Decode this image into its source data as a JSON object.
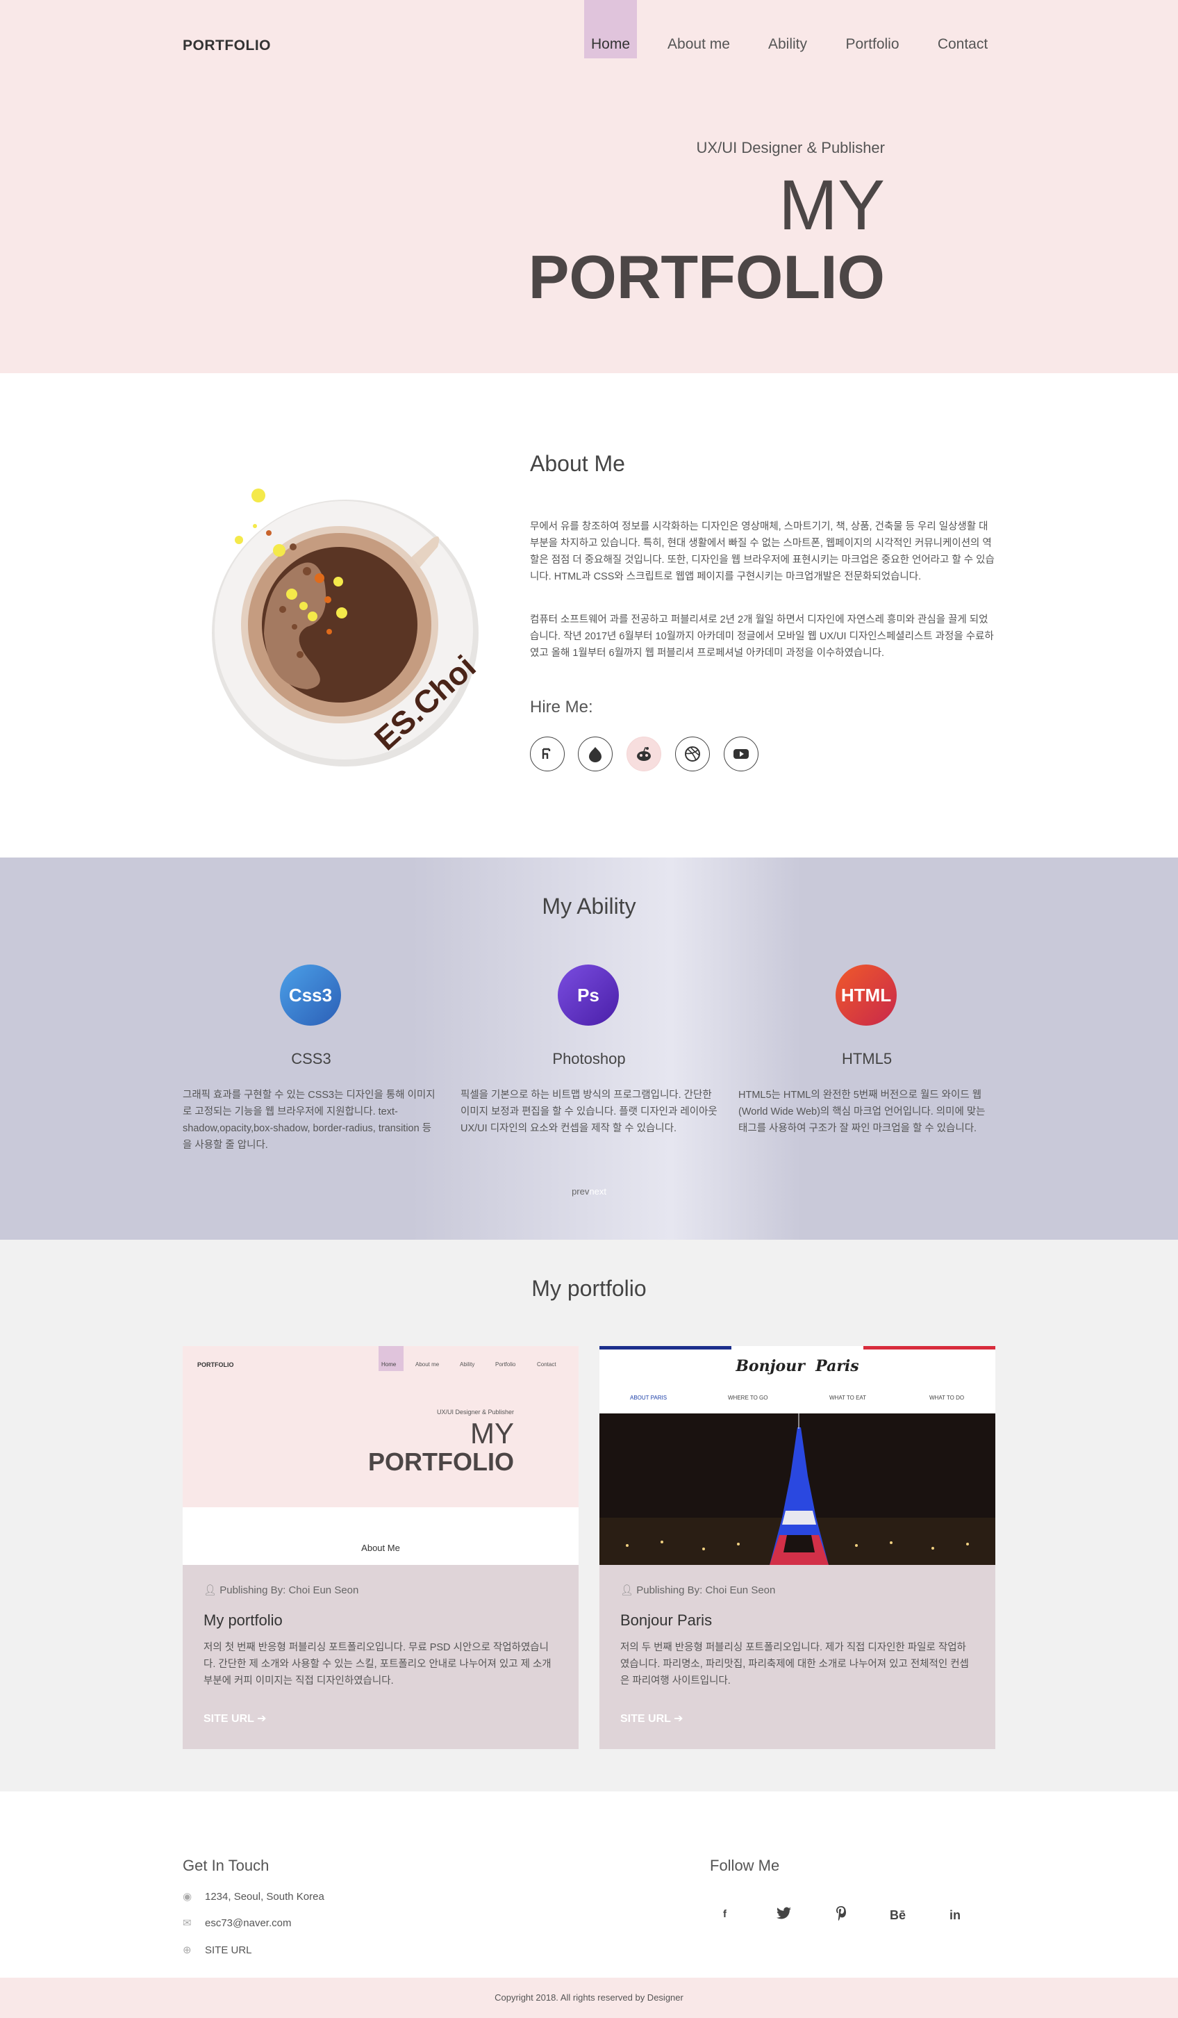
{
  "header": {
    "logo": "PORTFOLIO",
    "nav": [
      "Home",
      "About me",
      "Ability",
      "Portfolio",
      "Contact"
    ],
    "subtitle": "UX/UI Designer & Publisher",
    "title_line1": "MY",
    "title_line2": "PORTFOLIO"
  },
  "about": {
    "title": "About Me",
    "logo_text": "ES.Choi",
    "para1": "무에서 유를 창조하여 정보를 시각화하는 디자인은 영상매체, 스마트기기, 책, 상품, 건축물 등 우리 일상생활 대부분을 차지하고 있습니다. 특히, 현대 생활에서 빠질 수 없는 스마트폰, 웹페이지의 시각적인 커뮤니케이션의 역할은 점점 더 중요해질 것입니다. 또한, 디자인을 웹 브라우저에 표현시키는 마크업은 중요한 언어라고 할 수 있습니다. HTML과 CSS와 스크립트로 웹앱 페이지를 구현시키는 마크업개발은 전문화되었습니다.",
    "para2": "컴퓨터 소프트웨어 과를 전공하고 퍼블리셔로 2년 2개 월일 하면서 디자인에 자연스레 흥미와 관심을 끌게 되었습니다. 작년 2017년 6월부터 10월까지 아카데미 정글에서 모바일 웹 UX/UI 디자인스페셜리스트 과정을 수료하였고 올해 1월부터 6월까지 웹 퍼블리셔 프로페셔널 아카데미 과정을 이수하였습니다.",
    "hire_label": "Hire Me:",
    "social": [
      "behance-icon",
      "drupal-icon",
      "reddit-icon",
      "dribbble-icon",
      "youtube-icon"
    ]
  },
  "ability": {
    "title": "My Ability",
    "items": [
      {
        "icon": "Css3",
        "name": "CSS3",
        "text": "그래픽 효과를 구현할 수 있는 CSS3는 디자인을 통해 이미지로 고정되는 기능을 웹 브라우저에 지원합니다. text-shadow,opacity,box-shadow, border-radius, transition 등을 사용할 줄 압니다.",
        "color": "#3b7fd4"
      },
      {
        "icon": "Ps",
        "name": "Photoshop",
        "text": "픽셀을 기본으로 하는 비트맵 방식의 프로그램입니다. 간단한 이미지 보정과 편집을 할 수 있습니다. 플랫 디자인과 레이아웃 UX/UI 디자인의 요소와 컨셉을 제작 할 수 있습니다.",
        "color": "#5b35c6"
      },
      {
        "icon": "HTML",
        "name": "HTML5",
        "text": "HTML5는 HTML의 완전한 5번째 버전으로 월드 와이드 웹(World Wide Web)의 핵심 마크업 언어입니다. 의미에 맞는 태그를 사용하여 구조가 잘 짜인 마크업을 할 수 있습니다.",
        "color": "#e0452b"
      }
    ],
    "prev": "prev",
    "next": "next"
  },
  "portfolio": {
    "title": "My portfolio",
    "cards": [
      {
        "publisher": "Publishing By: Choi Eun Seon",
        "title": "My portfolio",
        "text": "저의 첫 번째 반응형 퍼블리싱 포트폴리오입니다. 무료 PSD 시안으로 작업하였습니다. 간단한 제 소개와 사용할 수 있는 스킬, 포트폴리오 안내로 나누어져 있고 제 소개 부분에 커피 이미지는 직접 디자인하였습니다.",
        "url": "SITE URL",
        "thumb": {
          "logo": "PORTFOLIO",
          "nav": [
            "Home",
            "About me",
            "Ability",
            "Portfolio",
            "Contact"
          ],
          "subtitle": "UX/UI Designer & Publisher",
          "title1": "MY",
          "title2": "PORTFOLIO",
          "about": "About Me"
        }
      },
      {
        "publisher": "Publishing By: Choi Eun Seon",
        "title": "Bonjour Paris",
        "text": "저의 두 번째 반응형 퍼블리싱 포트폴리오입니다. 제가 직접 디자인한 파일로 작업하였습니다. 파리명소, 파리맛집, 파리축제에 대한 소개로 나누어져 있고 전체적인 컨셉은 파리여행 사이트입니다.",
        "url": "SITE URL",
        "thumb": {
          "logo": "Bonjour  Paris",
          "nav": [
            "ABOUT PARIS",
            "WHERE TO GO",
            "WHAT TO EAT",
            "WHAT TO DO"
          ]
        }
      }
    ]
  },
  "footer": {
    "contact_title": "Get In Touch",
    "address": "1234, Seoul, South Korea",
    "email": "esc73@naver.com",
    "site": "SITE URL",
    "follow_title": "Follow Me",
    "follow": [
      "f",
      "twitter-icon",
      "pinterest-icon",
      "Bē",
      "in"
    ],
    "copyright": "Copyright 2018. All rights reserved by Designer"
  }
}
